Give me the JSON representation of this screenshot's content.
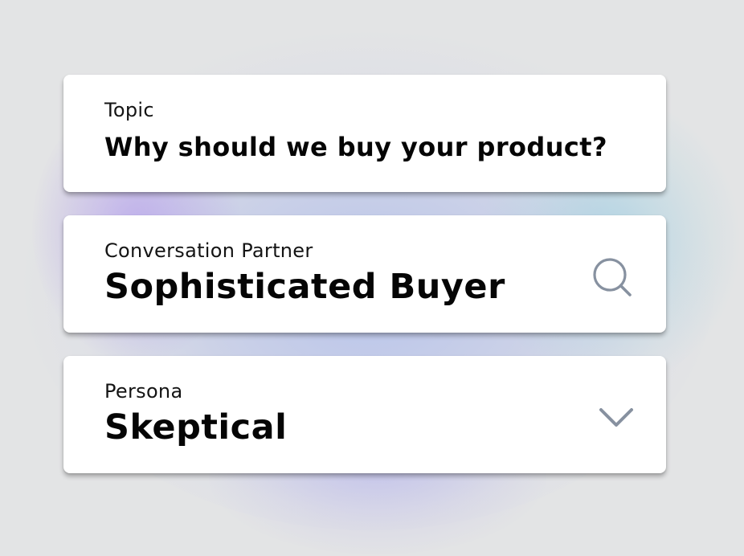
{
  "form": {
    "topic": {
      "label": "Topic",
      "value": "Why should we buy your product?"
    },
    "partner": {
      "label": "Conversation Partner",
      "value": "Sophisticated Buyer",
      "icon": "search-icon"
    },
    "persona": {
      "label": "Persona",
      "value": "Skeptical",
      "icon": "chevron-down-icon"
    }
  },
  "colors": {
    "background": "#e3e4e5",
    "card": "#ffffff",
    "text": "#050505",
    "icon": "#8791a0",
    "glow_blue": "#96aaf0",
    "glow_purple": "#aa8cf0",
    "glow_teal": "#8ccde1"
  }
}
